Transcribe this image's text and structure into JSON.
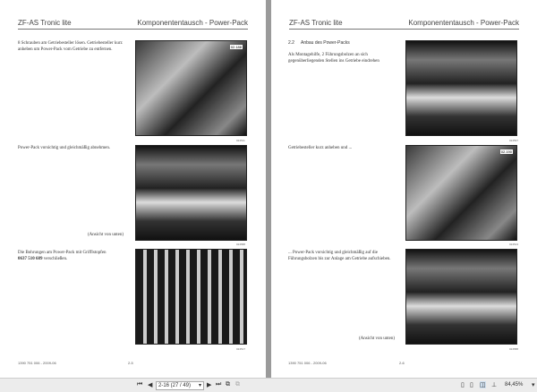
{
  "left_page": {
    "header_left": "ZF-AS Tronic lite",
    "header_right": "Komponententausch - Power-Pack",
    "step1": "8 Schrauben am Getriebesteller lösen. Getriebesteller kurz anheben um Power-Pack vom Getriebe zu entfernen.",
    "img1_tag": "02.188",
    "img1_code": "024511",
    "step2": "Power-Pack vorsichtig und gleichmäßig abnehmen.",
    "img2_caption": "(Ansicht von unten)",
    "img2_code": "024588",
    "step3_a": "Die Bohrungen am Power-Pack mit Grifflstopfen",
    "step3_part": "0637 510 689",
    "step3_b": " verschließen.",
    "img3_code": "024517",
    "footer_left": "1390 751 006 - 2009-06",
    "page_number": "2-5"
  },
  "right_page": {
    "header_left": "ZF-AS Tronic lite",
    "header_right": "Komponententausch - Power-Pack",
    "section_number": "2.2",
    "section_title": "Anbau des Power-Packs",
    "step1": "Als Montagehilfe, 2 Führungsbolzen an sich gegenüberliegenden Stellen ins Getriebe eindrehen",
    "img1_code": "024597",
    "step2": "Getriebesteller kurz anheben und ...",
    "img2_tag": "02.190",
    "img2_code": "024513",
    "step3": "... Power-Pack vorsichtig und gleichmäßig auf die Führungsbolzen bis zur Anlage am Getriebe aufschieben.",
    "img3_caption": "(Ansicht von unten)",
    "img3_code": "024588",
    "footer_left": "1390 751 006 - 2009-06",
    "page_number": "2-6"
  },
  "toolbar": {
    "page_field": "2-16 (27 / 49)",
    "zoom": "84,45%"
  }
}
